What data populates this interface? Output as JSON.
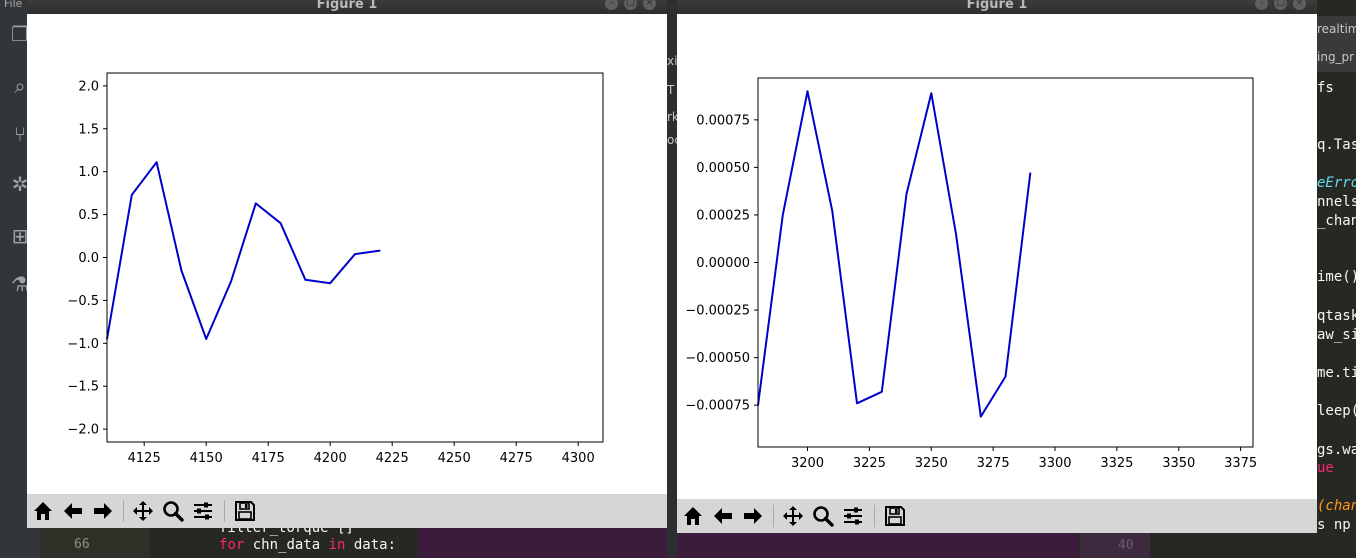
{
  "editor": {
    "menu_fragment": "File",
    "line_number": "66",
    "code_line_1": "filter_torque []",
    "code_kw_for": "for",
    "code_var": " chn_data ",
    "code_kw_in": "in",
    "code_tail": " data:",
    "minimap_number": "40",
    "right_tab_1": "realtim",
    "right_tab_2": "ing_pr",
    "right_code": [
      "fs",
      "q.Tas",
      "eErro",
      "nnels",
      "_chan",
      "ime()",
      "qtask",
      "aw_si",
      "me.ti",
      "leep(",
      "gs.wa",
      "ue",
      "(chan",
      "s np"
    ],
    "mid_fragments": [
      "xi",
      "T",
      "rk",
      "oc"
    ]
  },
  "figures": [
    {
      "title": "Figure 1",
      "chart_data": {
        "type": "line",
        "x": [
          4110,
          4120,
          4130,
          4140,
          4150,
          4160,
          4170,
          4180,
          4190,
          4200,
          4210,
          4220
        ],
        "series": [
          {
            "values": [
              -0.95,
              0.73,
              1.11,
              -0.15,
              -0.95,
              -0.28,
              0.63,
              0.4,
              -0.26,
              -0.3,
              0.04,
              0.08
            ],
            "color": "#0000cc"
          }
        ],
        "xlim": [
          4110,
          4310
        ],
        "ylim": [
          -2.15,
          2.15
        ],
        "xticks": [
          4125,
          4150,
          4175,
          4200,
          4225,
          4250,
          4275,
          4300
        ],
        "yticks": [
          -2.0,
          -1.5,
          -1.0,
          -0.5,
          0.0,
          0.5,
          1.0,
          1.5,
          2.0
        ],
        "xtick_labels": [
          "4125",
          "4150",
          "4175",
          "4200",
          "4225",
          "4250",
          "4275",
          "4300"
        ],
        "ytick_labels": [
          "−2.0",
          "−1.5",
          "−1.0",
          "−0.5",
          "0.0",
          "0.5",
          "1.0",
          "1.5",
          "2.0"
        ]
      }
    },
    {
      "title": "Figure 1",
      "chart_data": {
        "type": "line",
        "x": [
          3180,
          3190,
          3200,
          3210,
          3220,
          3230,
          3240,
          3250,
          3260,
          3270,
          3280,
          3290
        ],
        "series": [
          {
            "values": [
              -0.00075,
              0.00025,
              0.0009,
              0.00027,
              -0.00074,
              -0.00068,
              0.00036,
              0.00089,
              0.00015,
              -0.00081,
              -0.0006,
              0.00047
            ],
            "color": "#0000cc"
          }
        ],
        "xlim": [
          3180,
          3380
        ],
        "ylim": [
          -0.00097,
          0.00097
        ],
        "xticks": [
          3200,
          3225,
          3250,
          3275,
          3300,
          3325,
          3350,
          3375
        ],
        "yticks": [
          -0.00075,
          -0.0005,
          -0.00025,
          0.0,
          0.00025,
          0.0005,
          0.00075
        ],
        "xtick_labels": [
          "3200",
          "3225",
          "3250",
          "3275",
          "3300",
          "3325",
          "3350",
          "3375"
        ],
        "ytick_labels": [
          "−0.00075",
          "−0.00050",
          "−0.00025",
          "0.00000",
          "0.00025",
          "0.00050",
          "0.00075"
        ]
      }
    }
  ],
  "toolbar": {
    "icons": [
      "home-icon",
      "back-arrow-icon",
      "forward-arrow-icon",
      "pan-icon",
      "zoom-icon",
      "configure-subplots-icon",
      "save-icon"
    ]
  }
}
